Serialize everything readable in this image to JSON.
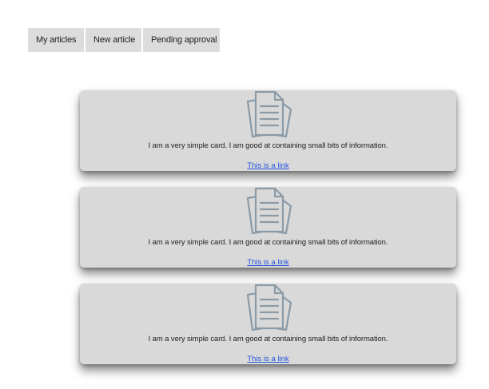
{
  "tabs": [
    {
      "label": "My articles"
    },
    {
      "label": "New article"
    },
    {
      "label": "Pending approval"
    }
  ],
  "cards": [
    {
      "icon": "document-stack-icon",
      "text": "I am a very simple card. I am good at containing small bits of information.",
      "link_label": "This is a link"
    },
    {
      "icon": "document-stack-icon",
      "text": "I am a very simple card. I am good at containing small bits of information.",
      "link_label": "This is a link"
    },
    {
      "icon": "document-stack-icon",
      "text": "I am a very simple card. I am good at containing small bits of information.",
      "link_label": "This is a link"
    }
  ],
  "colors": {
    "tab_background": "#dcdcdc",
    "card_background": "#d9d9d9",
    "icon_stroke": "#8a9aa6",
    "link": "#2255dd"
  }
}
